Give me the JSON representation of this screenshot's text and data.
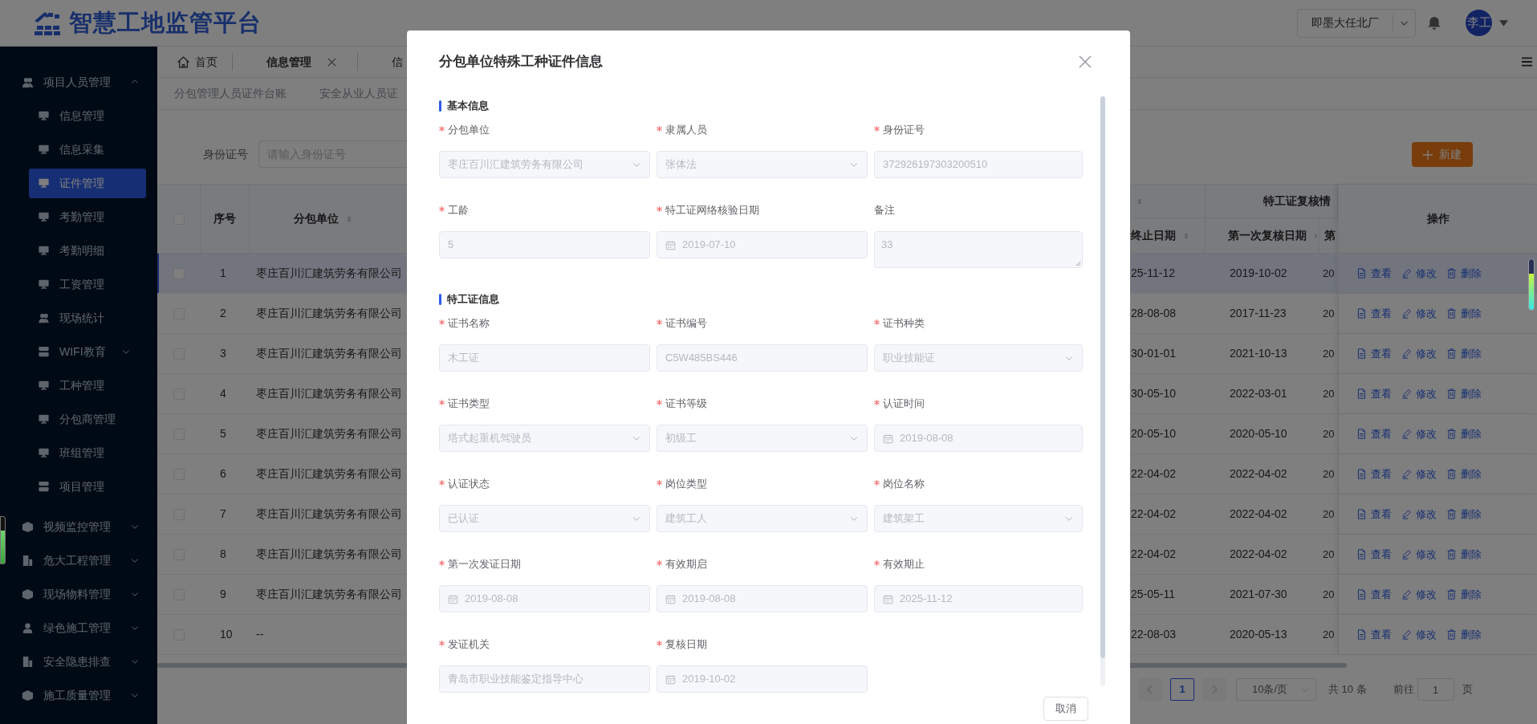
{
  "header": {
    "logo_text": "智慧工地监管平台",
    "site_select": "即墨大任北厂",
    "avatar": "李工"
  },
  "sidebar": {
    "items": [
      {
        "label": "项目人员管理",
        "expanded": true,
        "children": [
          {
            "label": "信息管理",
            "kind": "item",
            "selected": false
          },
          {
            "label": "信息采集",
            "kind": "item",
            "selected": false
          },
          {
            "label": "证件管理",
            "kind": "item",
            "selected": true
          },
          {
            "label": "考勤管理",
            "kind": "item",
            "selected": false
          },
          {
            "label": "考勤明细",
            "kind": "item",
            "selected": false
          },
          {
            "label": "工资管理",
            "kind": "item",
            "selected": false
          },
          {
            "label": "现场统计",
            "kind": "item",
            "selected": false
          },
          {
            "label": "WIFI教育",
            "kind": "group",
            "selected": false,
            "expanded": false
          },
          {
            "label": "工种管理",
            "kind": "item",
            "selected": false
          },
          {
            "label": "分包商管理",
            "kind": "item",
            "selected": false
          },
          {
            "label": "班组管理",
            "kind": "item",
            "selected": false
          },
          {
            "label": "项目管理",
            "kind": "item",
            "selected": false
          }
        ]
      },
      {
        "label": "视频监控管理",
        "expanded": false
      },
      {
        "label": "危大工程管理",
        "expanded": false
      },
      {
        "label": "现场物料管理",
        "expanded": false
      },
      {
        "label": "绿色施工管理",
        "expanded": false
      },
      {
        "label": "安全隐患排查",
        "expanded": false
      },
      {
        "label": "施工质量管理",
        "expanded": false
      }
    ]
  },
  "tabs": [
    {
      "label": "首页",
      "kind": "home",
      "selected": false,
      "closable": false
    },
    {
      "label": "信息管理",
      "kind": "page",
      "selected": true,
      "closable": true
    },
    {
      "label": "信",
      "kind": "page",
      "selected": false,
      "closable": false
    }
  ],
  "sub_tabs": [
    {
      "label": "分包管理人员证件台账",
      "selected": false
    },
    {
      "label": "安全从业人员证",
      "selected": false
    }
  ],
  "search": {
    "label": "身份证号",
    "placeholder": "请输入身份证号"
  },
  "new_button": "新建",
  "table": {
    "select_all_checked": false,
    "header_groups": [
      {
        "sortable": true
      },
      {
        "label": "特工证复核情"
      }
    ],
    "columns": [
      {
        "label": "序号",
        "sortable": false
      },
      {
        "label": "分包单位",
        "sortable": true
      },
      {
        "label": "终止日期",
        "sortable": true
      },
      {
        "label": "第一次复核日期",
        "sortable": true
      },
      {
        "label": "第"
      },
      {
        "label": "操作",
        "sortable": false
      }
    ],
    "rows": [
      {
        "checked": false,
        "selected": true,
        "index": "1",
        "unit": "枣庄百川汇建筑劳务有限公司",
        "column_3": "25-11-12",
        "first_review": "2019-10-02",
        "column_5": "20",
        "actions": [
          "查看",
          "修改",
          "删除"
        ]
      },
      {
        "checked": false,
        "selected": false,
        "index": "2",
        "unit": "枣庄百川汇建筑劳务有限公司",
        "column_3": "28-08-08",
        "first_review": "2017-11-23",
        "column_5": "20",
        "actions": [
          "查看",
          "修改",
          "删除"
        ]
      },
      {
        "checked": false,
        "selected": false,
        "index": "3",
        "unit": "枣庄百川汇建筑劳务有限公司",
        "column_3": "30-01-01",
        "first_review": "2021-10-13",
        "column_5": "20",
        "actions": [
          "查看",
          "修改",
          "删除"
        ]
      },
      {
        "checked": false,
        "selected": false,
        "index": "4",
        "unit": "枣庄百川汇建筑劳务有限公司",
        "column_3": "30-05-10",
        "first_review": "2022-03-01",
        "column_5": "20",
        "actions": [
          "查看",
          "修改",
          "删除"
        ]
      },
      {
        "checked": false,
        "selected": false,
        "index": "5",
        "unit": "枣庄百川汇建筑劳务有限公司",
        "column_3": "20-05-10",
        "first_review": "2020-05-10",
        "column_5": "20",
        "actions": [
          "查看",
          "修改",
          "删除"
        ]
      },
      {
        "checked": false,
        "selected": false,
        "index": "6",
        "unit": "枣庄百川汇建筑劳务有限公司",
        "column_3": "22-04-02",
        "first_review": "2022-04-02",
        "column_5": "20",
        "actions": [
          "查看",
          "修改",
          "删除"
        ]
      },
      {
        "checked": false,
        "selected": false,
        "index": "7",
        "unit": "枣庄百川汇建筑劳务有限公司",
        "column_3": "22-04-02",
        "first_review": "2022-04-02",
        "column_5": "20",
        "actions": [
          "查看",
          "修改",
          "删除"
        ]
      },
      {
        "checked": false,
        "selected": false,
        "index": "8",
        "unit": "枣庄百川汇建筑劳务有限公司",
        "column_3": "22-04-02",
        "first_review": "2022-04-02",
        "column_5": "20",
        "actions": [
          "查看",
          "修改",
          "删除"
        ]
      },
      {
        "checked": false,
        "selected": false,
        "index": "9",
        "unit": "枣庄百川汇建筑劳务有限公司",
        "column_3": "25-05-11",
        "first_review": "2021-07-30",
        "column_5": "20",
        "actions": [
          "查看",
          "修改",
          "删除"
        ]
      },
      {
        "checked": false,
        "selected": false,
        "index": "10",
        "unit": "--",
        "column_3": "22-08-03",
        "first_review": "2020-05-13",
        "column_5": "20",
        "actions": [
          "查看",
          "修改",
          "删除"
        ]
      }
    ]
  },
  "pagination": {
    "pages": [
      {
        "label": "1",
        "selected": true
      }
    ],
    "page_size": "10条/页",
    "total": "共 10 条",
    "goto_label": "前往",
    "goto_value": "1",
    "page_unit": "页"
  },
  "modal": {
    "title": "分包单位特殊工种证件信息",
    "sections": [
      {
        "title": "基本信息",
        "fields": [
          {
            "label": "分包单位",
            "required": true,
            "kind": "select",
            "disabled": true,
            "value": "枣庄百川汇建筑劳务有限公司"
          },
          {
            "label": "隶属人员",
            "required": true,
            "kind": "select",
            "disabled": true,
            "value": "张体法"
          },
          {
            "label": "身份证号",
            "required": true,
            "kind": "input",
            "disabled": true,
            "value": "372926197303200510"
          },
          {
            "label": "工龄",
            "required": true,
            "kind": "input",
            "disabled": true,
            "value": "5"
          },
          {
            "label": "特工证网络核验日期",
            "required": true,
            "kind": "date",
            "disabled": true,
            "value": "2019-07-10"
          },
          {
            "label": "备注",
            "required": false,
            "kind": "textarea",
            "disabled": true,
            "value": "33"
          }
        ]
      },
      {
        "title": "特工证信息",
        "fields": [
          {
            "label": "证书名称",
            "required": true,
            "kind": "input",
            "disabled": true,
            "value": "木工证"
          },
          {
            "label": "证书编号",
            "required": true,
            "kind": "input",
            "disabled": true,
            "value": "C5W485BS446"
          },
          {
            "label": "证书种类",
            "required": true,
            "kind": "select",
            "disabled": true,
            "value": "职业技能证"
          },
          {
            "label": "证书类型",
            "required": true,
            "kind": "select",
            "disabled": true,
            "value": "塔式起重机驾驶员"
          },
          {
            "label": "证书等级",
            "required": true,
            "kind": "select",
            "disabled": true,
            "value": "初级工"
          },
          {
            "label": "认证时间",
            "required": true,
            "kind": "date",
            "disabled": true,
            "value": "2019-08-08"
          },
          {
            "label": "认证状态",
            "required": true,
            "kind": "select",
            "disabled": true,
            "value": "已认证"
          },
          {
            "label": "岗位类型",
            "required": true,
            "kind": "select",
            "disabled": true,
            "value": "建筑工人"
          },
          {
            "label": "岗位名称",
            "required": true,
            "kind": "select",
            "disabled": true,
            "value": "建筑架工"
          },
          {
            "label": "第一次发证日期",
            "required": true,
            "kind": "date",
            "disabled": true,
            "value": "2019-08-08"
          },
          {
            "label": "有效期启",
            "required": true,
            "kind": "date",
            "disabled": true,
            "value": "2019-08-08"
          },
          {
            "label": "有效期止",
            "required": true,
            "kind": "date",
            "disabled": true,
            "value": "2025-11-12"
          },
          {
            "label": "发证机关",
            "required": true,
            "kind": "input",
            "disabled": true,
            "value": "青岛市职业技能鉴定指导中心"
          },
          {
            "label": "复核日期",
            "required": true,
            "kind": "date",
            "disabled": true,
            "value": "2019-10-02"
          }
        ]
      }
    ],
    "buttons": [
      "取消"
    ]
  }
}
